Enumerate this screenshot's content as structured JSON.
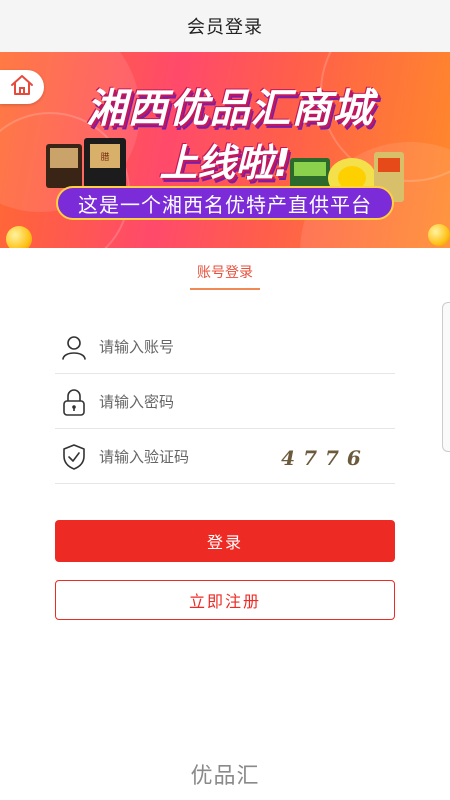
{
  "header": {
    "title": "会员登录"
  },
  "banner": {
    "title_line1": "湘西优品汇商城",
    "title_line2": "上线啦!",
    "subtitle": "这是一个湘西名优特产直供平台"
  },
  "tabs": {
    "account_login": "账号登录"
  },
  "form": {
    "account_placeholder": "请输入账号",
    "password_placeholder": "请输入密码",
    "captcha_placeholder": "请输入验证码",
    "captcha_code": "4776"
  },
  "buttons": {
    "login": "登录",
    "register": "立即注册"
  },
  "footer": {
    "logo_text": "优品汇"
  },
  "colors": {
    "primary_red": "#ee2a24",
    "tab_orange": "#e7513d"
  },
  "icons": {
    "home": "home-icon",
    "user": "user-icon",
    "lock": "lock-icon",
    "shield": "shield-check-icon"
  }
}
